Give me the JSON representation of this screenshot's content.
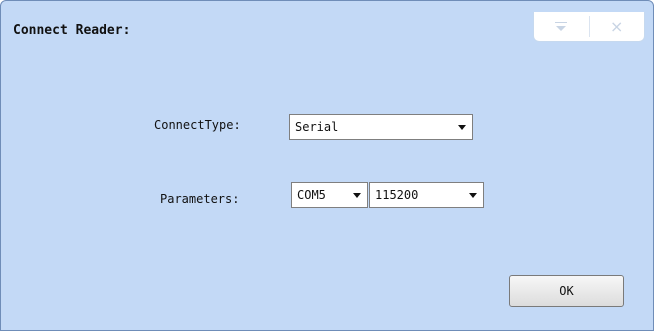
{
  "dialog": {
    "title": "Connect Reader:",
    "window_controls": {
      "menu_icon": "menu-dropdown-icon",
      "close_label": "×"
    }
  },
  "connect_type": {
    "label": "ConnectType:",
    "value": "Serial"
  },
  "parameters": {
    "label": "Parameters:",
    "port_value": "COM5",
    "baud_value": "115200"
  },
  "buttons": {
    "ok_label": "OK"
  },
  "colors": {
    "window_bg": "#c3d9f6",
    "border": "#6f8db8"
  }
}
